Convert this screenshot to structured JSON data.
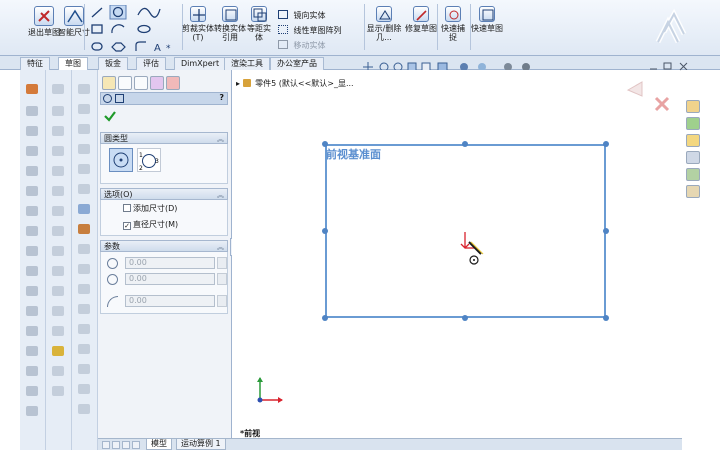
{
  "ribbon": {
    "exit_sketch_label": "退出草图",
    "smart_dim_label": "智能尺寸",
    "trim_entities_label": "剪裁实体(T)",
    "convert_entities_label": "转换实体引用",
    "offset_entities_label": "等距实体",
    "mirror_entities_label": "镜向实体",
    "linear_pattern_label": "线性草图阵列",
    "move_entities_label": "移动实体",
    "display_delete_label": "显示/删除几...",
    "repair_sketch_label": "修复草图",
    "quick_snap_label": "快速捕捉",
    "rapid_sketch_label": "快速草图"
  },
  "tabs": [
    "特征",
    "草图",
    "钣金",
    "评估",
    "DimXpert",
    "渲染工具",
    "办公室产品"
  ],
  "active_tab_index": 1,
  "property_manager": {
    "title_help": "?",
    "group_type": {
      "label": "圆类型"
    },
    "group_options": {
      "label": "选项(O)",
      "add_dimension": "添加尺寸(D)",
      "diameter_dimension": "直径尺寸(M)",
      "add_dimension_checked": false,
      "diameter_dimension_checked": true
    },
    "group_params": {
      "label": "参数",
      "cx": "0.00",
      "cy": "0.00",
      "radius": "0.00"
    }
  },
  "graphics": {
    "tree_crumb": "零件5   (默认<<默认>_显...",
    "plane_label": "前视基准面",
    "view_label": "*前视"
  },
  "bottom_tabs": [
    "模型",
    "运动算例 1"
  ],
  "colors": {
    "plane_border": "#6a9bd3",
    "accent": "#4f84c4",
    "origin_red": "#d9232e"
  }
}
